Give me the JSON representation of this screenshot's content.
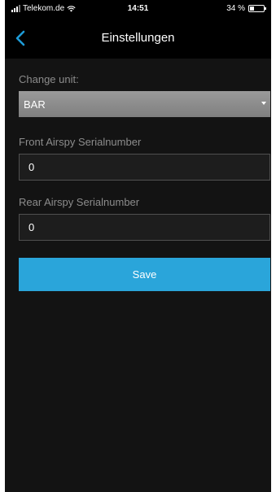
{
  "status_bar": {
    "carrier": "Telekom.de",
    "time": "14:51",
    "battery": "34 %",
    "battery_level": 0.34
  },
  "nav": {
    "title": "Einstellungen",
    "back_icon": "chevron-left-icon"
  },
  "form": {
    "unit_label": "Change unit:",
    "unit_value": "BAR",
    "front_label": "Front Airspy Serialnumber",
    "front_value": "0",
    "rear_label": "Rear Airspy Serialnumber",
    "rear_value": "0",
    "save_label": "Save"
  },
  "colors": {
    "accent": "#2aa5da",
    "back_icon": "#1e9bd7",
    "background": "#131313"
  }
}
